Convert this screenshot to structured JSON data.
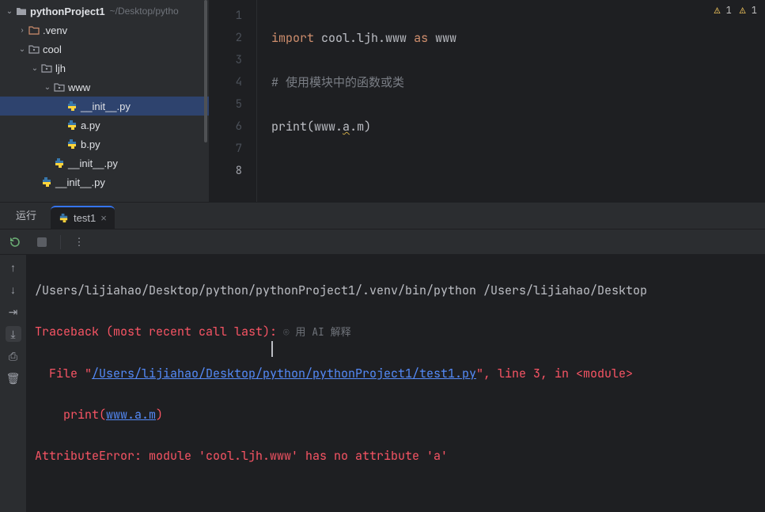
{
  "project": {
    "name": "pythonProject1",
    "path": "~/Desktop/pytho"
  },
  "tree": {
    "venv": ".venv",
    "cool": "cool",
    "ljh": "ljh",
    "www": "www",
    "file_init_www": "__init__.py",
    "file_a": "a.py",
    "file_b": "b.py",
    "file_init_ljh": "__init__.py",
    "file_init_cool": "__init__.py"
  },
  "editor": {
    "warnings": {
      "count1": "1",
      "count2": "1"
    },
    "lines": [
      "1",
      "2",
      "3",
      "4",
      "5",
      "6",
      "7",
      "8"
    ],
    "code": {
      "l1": {
        "kw1": "import",
        "mod": "cool.ljh.www",
        "kw2": "as",
        "alias": "www"
      },
      "l2": "# 使用模块中的函数或类",
      "l3": {
        "fn": "print",
        "open": "(",
        "obj": "www.",
        "attr": "a",
        "rest": ".m",
        "close": ")"
      }
    }
  },
  "run": {
    "panel_title": "运行",
    "tab": "test1",
    "ai_hint": "用 AI 解释"
  },
  "console": {
    "cmd": "/Users/lijiahao/Desktop/python/pythonProject1/.venv/bin/python /Users/lijiahao/Desktop",
    "tb": "Traceback (most recent call last):",
    "file_pre": "  File \"",
    "file_link": "/Users/lijiahao/Desktop/python/pythonProject1/test1.py",
    "file_post": "\", line 3, in <module>",
    "line3_pre": "    print(",
    "line3_link": "www.a.m",
    "line3_post": ")",
    "err": "AttributeError: module 'cool.ljh.www' has no attribute 'a'"
  }
}
